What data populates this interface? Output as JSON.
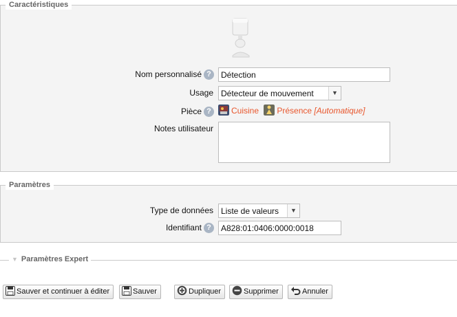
{
  "characteristics": {
    "legend": "Caractéristiques",
    "device_icon": "motion-sensor-icon",
    "fields": {
      "name": {
        "label": "Nom personnalisé",
        "value": "Détection"
      },
      "usage": {
        "label": "Usage",
        "value": "Détecteur de mouvement"
      },
      "room": {
        "label": "Pièce",
        "room_name": "Cuisine",
        "room_icon": "kitchen-icon",
        "scenario_name": "Présence",
        "scenario_icon": "presence-icon",
        "scenario_mode": "[Automatique]"
      },
      "notes": {
        "label": "Notes utilisateur",
        "value": ""
      }
    }
  },
  "parameters": {
    "legend": "Paramètres",
    "fields": {
      "data_type": {
        "label": "Type de données",
        "value": "Liste de valeurs"
      },
      "identifier": {
        "label": "Identifiant",
        "value": "A828:01:0406:0000:0018"
      }
    }
  },
  "expert": {
    "legend": "Paramètres Expert",
    "icon": "triangle-down-icon"
  },
  "buttons": {
    "save_continue": "Sauver et continuer à éditer",
    "save": "Sauver",
    "duplicate": "Dupliquer",
    "delete": "Supprimer",
    "cancel": "Annuler"
  },
  "colors": {
    "link": "#e8552b",
    "border": "#c9c9c9",
    "panel": "#f4f4f4"
  }
}
